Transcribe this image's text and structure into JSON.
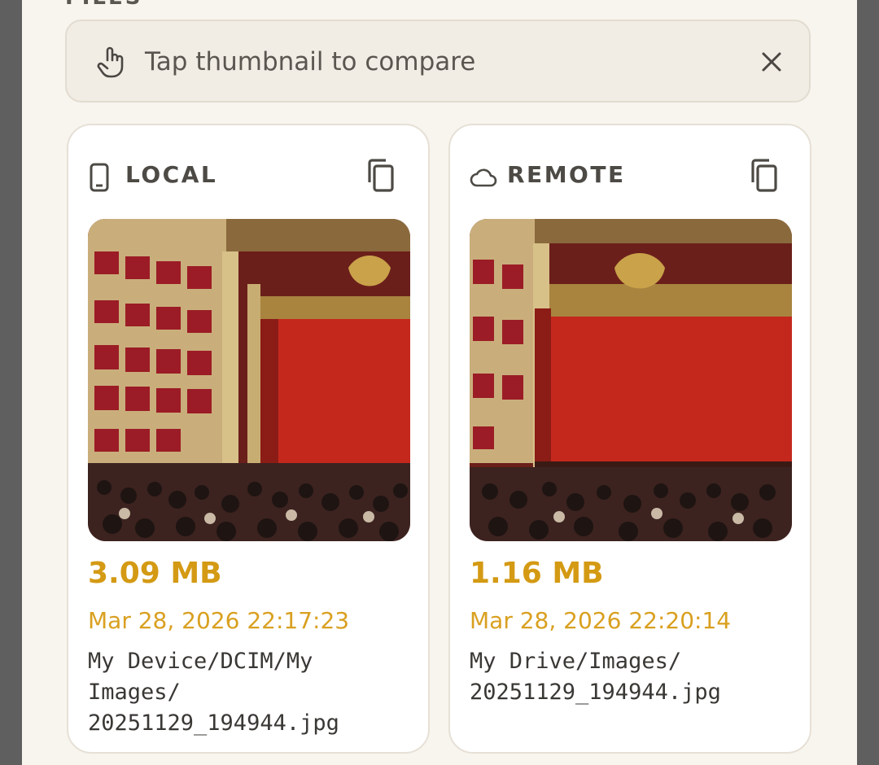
{
  "section": {
    "title": "FILES"
  },
  "hint": {
    "text": "Tap thumbnail to compare",
    "icon": "touch-icon",
    "close_icon": "close-icon"
  },
  "colors": {
    "accent": "#d49a14",
    "date": "#d9a020",
    "card_bg": "#ffffff",
    "sheet_bg": "#f8f5ef"
  },
  "local": {
    "label": "LOCAL",
    "icon": "phone-icon",
    "size": "3.09 MB",
    "modified": "Mar 28, 2026 22:17:23",
    "path": "My Device/DCIM/My\nImages/\n20251129_194944.jpg"
  },
  "remote": {
    "label": "REMOTE",
    "icon": "cloud-icon",
    "size": "1.16 MB",
    "modified": "Mar 28, 2026 22:20:14",
    "path": "My Drive/Images/\n20251129_194944.jpg"
  }
}
